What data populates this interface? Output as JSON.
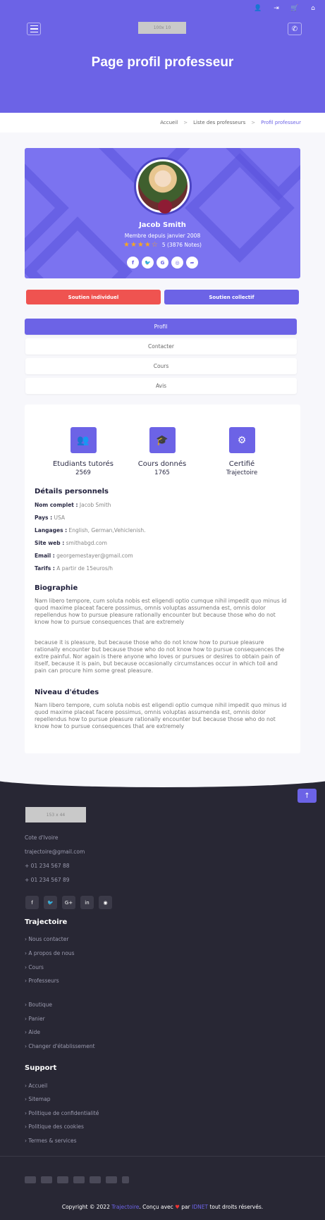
{
  "topbar": {
    "icons": [
      "user-icon",
      "sign-in-icon",
      "cart-icon",
      "home-icon"
    ],
    "glyphs": [
      "👤",
      "⇥",
      "🛒",
      "⌂"
    ]
  },
  "header": {
    "logo_placeholder": "100x 10",
    "title": "Page profil professeur",
    "phone_glyph": "✆"
  },
  "breadcrumb": {
    "items": [
      "Accueil",
      "Liste des professeurs",
      "Profil professeur"
    ],
    "separator": ">"
  },
  "profile": {
    "name": "Jacob Smith",
    "member_since": "Membre depuis janvier 2008",
    "stars": "★★★★☆",
    "rating_text": "5 (3876 Notes)",
    "socials": [
      "f",
      "🐦",
      "G",
      "◎",
      "➦"
    ]
  },
  "support": {
    "individual": "Soutien individuel",
    "collective": "Soutien collectif"
  },
  "tabs": [
    "Profil",
    "Contacter",
    "Cours",
    "Avis"
  ],
  "stats": [
    {
      "label": "Etudiants tutorés",
      "value": "2569",
      "glyph": "👥"
    },
    {
      "label": "Cours donnés",
      "value": "1765",
      "glyph": "🎓"
    },
    {
      "label": "Certifié",
      "value": "Trajectoire",
      "glyph": "⚙"
    }
  ],
  "details": {
    "title": "Détails personnels",
    "rows": [
      {
        "k": "Nom complet :",
        "v": "Jacob Smith"
      },
      {
        "k": "Pays :",
        "v": "USA"
      },
      {
        "k": "Langages :",
        "v": "English, German,Vehiclenish."
      },
      {
        "k": "Site web :",
        "v": "smithabgd.com"
      },
      {
        "k": "Email :",
        "v": "georgemestayer@gmail.com"
      },
      {
        "k": "Tarifs :",
        "v": "A partir de 15euros/h"
      }
    ]
  },
  "bio": {
    "title": "Biographie",
    "p1": "Nam libero tempore, cum soluta nobis est eligendi optio cumque nihil impedit quo minus id quod maxime placeat facere possimus, omnis voluptas assumenda est, omnis dolor repellendus how to pursue pleasure rationally encounter but because those who do not know how to pursue consequences that are extremely",
    "p2": "because it is pleasure, but because those who do not know how to pursue pleasure rationally encounter but because those who do not know how to pursue consequences the extre painful. Nor again is there anyone who loves or pursues or desires to obtain pain of itself, because it is pain, but because occasionally circumstances occur in which toil and pain can procure him some great pleasure."
  },
  "level": {
    "title": "Niveau d'études",
    "p": "Nam libero tempore, cum soluta nobis est eligendi optio cumque nihil impedit quo minus id quod maxime placeat facere possimus, omnis voluptas assumenda est, omnis dolor repellendus how to pursue pleasure rationally encounter but because those who do not know how to pursue consequences that are extremely"
  },
  "footer": {
    "to_top": "↑",
    "logo_placeholder": "153 x 44",
    "contact": [
      "Cote d'Ivoire",
      "trajectoire@gmail.com",
      "+ 01 234 567 88",
      "+ 01 234 567 89"
    ],
    "socials": [
      "f",
      "🐦",
      "G+",
      "in",
      "◉"
    ],
    "trajectoire_title": "Trajectoire",
    "links1": [
      "Nous contacter",
      "A propos de nous",
      "Cours",
      "Professeurs"
    ],
    "links2": [
      "Boutique",
      "Panier",
      "Aide",
      "Changer d'établissement"
    ],
    "support_title": "Support",
    "links3": [
      "Accueil",
      "Sitemap",
      "Politique de confidentialité",
      "Politique des cookies",
      "Termes & services"
    ],
    "copy_pre": "Copyright © 2022",
    "copy_brand": "Trajectoire",
    "copy_mid": ". Conçu avec",
    "copy_heart": "♥",
    "copy_par": "par",
    "copy_author": "IDNET",
    "copy_end": "tout droits réservés."
  }
}
